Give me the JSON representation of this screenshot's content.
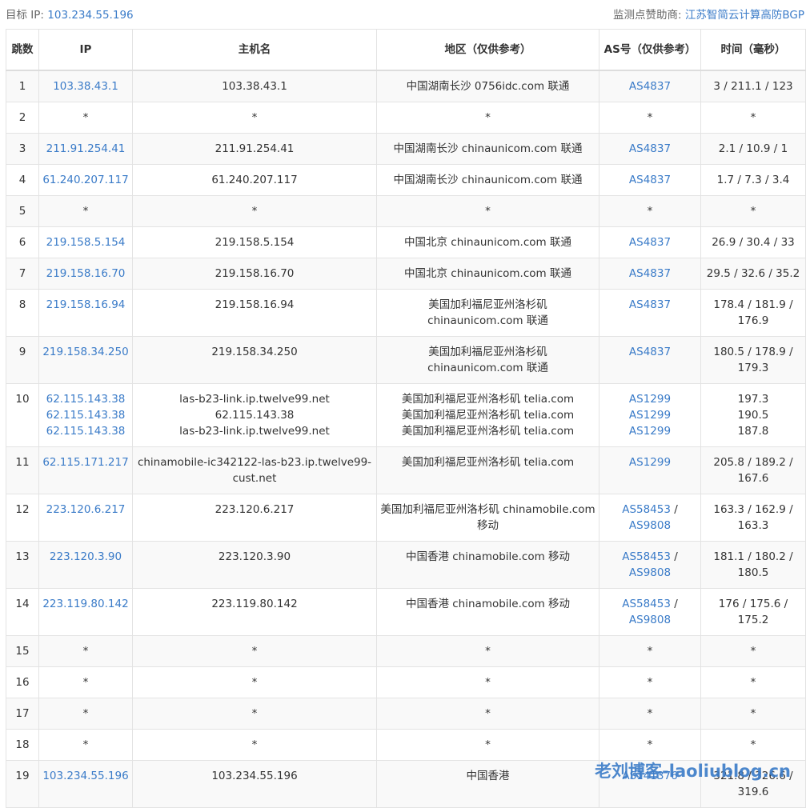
{
  "header": {
    "target_label": "目标 IP:",
    "target_ip": "103.234.55.196",
    "sponsor_label": "监测点赞助商:",
    "sponsor_name": "江苏智简云计算高防BGP"
  },
  "columns": [
    "跳数",
    "IP",
    "主机名",
    "地区（仅供参考）",
    "AS号（仅供参考）",
    "时间（毫秒）"
  ],
  "rows": [
    {
      "hop": "1",
      "ip": [
        "103.38.43.1"
      ],
      "host": [
        "103.38.43.1"
      ],
      "region": [
        "中国湖南长沙 0756idc.com 联通"
      ],
      "as": [
        "AS4837"
      ],
      "time": "3 / 211.1 / 123"
    },
    {
      "hop": "2",
      "ip": [
        "*"
      ],
      "host": [
        "*"
      ],
      "region": [
        "*"
      ],
      "as": [
        "*"
      ],
      "time": "*"
    },
    {
      "hop": "3",
      "ip": [
        "211.91.254.41"
      ],
      "host": [
        "211.91.254.41"
      ],
      "region": [
        "中国湖南长沙 chinaunicom.com 联通"
      ],
      "as": [
        "AS4837"
      ],
      "time": "2.1 / 10.9 / 1"
    },
    {
      "hop": "4",
      "ip": [
        "61.240.207.117"
      ],
      "host": [
        "61.240.207.117"
      ],
      "region": [
        "中国湖南长沙 chinaunicom.com 联通"
      ],
      "as": [
        "AS4837"
      ],
      "time": "1.7 / 7.3 / 3.4"
    },
    {
      "hop": "5",
      "ip": [
        "*"
      ],
      "host": [
        "*"
      ],
      "region": [
        "*"
      ],
      "as": [
        "*"
      ],
      "time": "*"
    },
    {
      "hop": "6",
      "ip": [
        "219.158.5.154"
      ],
      "host": [
        "219.158.5.154"
      ],
      "region": [
        "中国北京 chinaunicom.com 联通"
      ],
      "as": [
        "AS4837"
      ],
      "time": "26.9 / 30.4 / 33"
    },
    {
      "hop": "7",
      "ip": [
        "219.158.16.70"
      ],
      "host": [
        "219.158.16.70"
      ],
      "region": [
        "中国北京 chinaunicom.com 联通"
      ],
      "as": [
        "AS4837"
      ],
      "time": "29.5 / 32.6 / 35.2"
    },
    {
      "hop": "8",
      "ip": [
        "219.158.16.94"
      ],
      "host": [
        "219.158.16.94"
      ],
      "region": [
        "美国加利福尼亚州洛杉矶 chinaunicom.com 联通"
      ],
      "as": [
        "AS4837"
      ],
      "time": "178.4 / 181.9 / 176.9"
    },
    {
      "hop": "9",
      "ip": [
        "219.158.34.250"
      ],
      "host": [
        "219.158.34.250"
      ],
      "region": [
        "美国加利福尼亚州洛杉矶 chinaunicom.com 联通"
      ],
      "as": [
        "AS4837"
      ],
      "time": "180.5 / 178.9 / 179.3"
    },
    {
      "hop": "10",
      "ip": [
        "62.115.143.38",
        "62.115.143.38",
        "62.115.143.38"
      ],
      "host": [
        "las-b23-link.ip.twelve99.net",
        "62.115.143.38",
        "las-b23-link.ip.twelve99.net"
      ],
      "region": [
        "美国加利福尼亚州洛杉矶 telia.com",
        "美国加利福尼亚州洛杉矶 telia.com",
        "美国加利福尼亚州洛杉矶 telia.com"
      ],
      "as": [
        "AS1299",
        "AS1299",
        "AS1299"
      ],
      "time": "197.3\n190.5\n187.8"
    },
    {
      "hop": "11",
      "ip": [
        "62.115.171.217"
      ],
      "host": [
        "chinamobile-ic342122-las-b23.ip.twelve99-cust.net"
      ],
      "region": [
        "美国加利福尼亚州洛杉矶 telia.com"
      ],
      "as": [
        "AS1299"
      ],
      "time": "205.8 / 189.2 / 167.6"
    },
    {
      "hop": "12",
      "ip": [
        "223.120.6.217"
      ],
      "host": [
        "223.120.6.217"
      ],
      "region": [
        "美国加利福尼亚州洛杉矶 chinamobile.com 移动"
      ],
      "as": [
        "AS58453",
        "AS9808"
      ],
      "time": "163.3 / 162.9 / 163.3"
    },
    {
      "hop": "13",
      "ip": [
        "223.120.3.90"
      ],
      "host": [
        "223.120.3.90"
      ],
      "region": [
        "中国香港 chinamobile.com 移动"
      ],
      "as": [
        "AS58453",
        "AS9808"
      ],
      "time": "181.1 / 180.2 / 180.5"
    },
    {
      "hop": "14",
      "ip": [
        "223.119.80.142"
      ],
      "host": [
        "223.119.80.142"
      ],
      "region": [
        "中国香港 chinamobile.com 移动"
      ],
      "as": [
        "AS58453",
        "AS9808"
      ],
      "time": "176 / 175.6 / 175.2"
    },
    {
      "hop": "15",
      "ip": [
        "*"
      ],
      "host": [
        "*"
      ],
      "region": [
        "*"
      ],
      "as": [
        "*"
      ],
      "time": "*"
    },
    {
      "hop": "16",
      "ip": [
        "*"
      ],
      "host": [
        "*"
      ],
      "region": [
        "*"
      ],
      "as": [
        "*"
      ],
      "time": "*"
    },
    {
      "hop": "17",
      "ip": [
        "*"
      ],
      "host": [
        "*"
      ],
      "region": [
        "*"
      ],
      "as": [
        "*"
      ],
      "time": "*"
    },
    {
      "hop": "18",
      "ip": [
        "*"
      ],
      "host": [
        "*"
      ],
      "region": [
        "*"
      ],
      "as": [
        "*"
      ],
      "time": "*"
    },
    {
      "hop": "19",
      "ip": [
        "103.234.55.196"
      ],
      "host": [
        "103.234.55.196"
      ],
      "region": [
        "中国香港"
      ],
      "as": [
        "AS141376"
      ],
      "time": "321.8 / 326.6 / 319.6"
    }
  ],
  "watermark": "老刘博客-laoliublog.cn",
  "colors": {
    "link": "#3a7bc8",
    "border": "#e3e3e3",
    "stripe": "#f9f9f9"
  }
}
